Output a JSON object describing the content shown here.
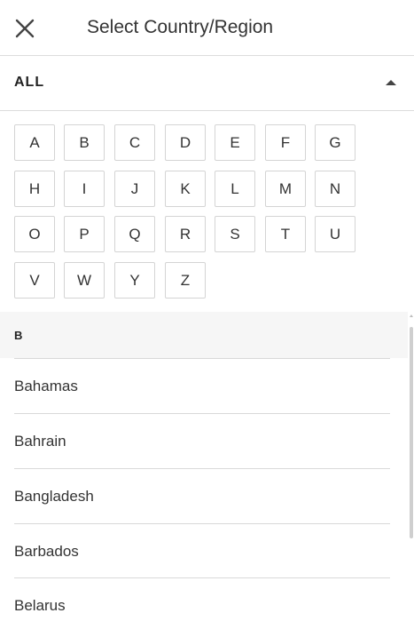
{
  "header": {
    "title": "Select Country/Region",
    "close_icon": "close-icon"
  },
  "filter": {
    "label": "ALL",
    "caret_icon": "caret-up-icon",
    "expanded": true
  },
  "letters": [
    "A",
    "B",
    "C",
    "D",
    "E",
    "F",
    "G",
    "H",
    "I",
    "J",
    "K",
    "L",
    "M",
    "N",
    "O",
    "P",
    "Q",
    "R",
    "S",
    "T",
    "U",
    "V",
    "W",
    "Y",
    "Z"
  ],
  "list": {
    "section": "B",
    "countries": [
      "Bahamas",
      "Bahrain",
      "Bangladesh",
      "Barbados",
      "Belarus"
    ]
  },
  "colors": {
    "border": "#dcdcdc",
    "section_bg": "#f6f6f6",
    "text": "#333333",
    "scrollbar": "#cfcfcf"
  }
}
